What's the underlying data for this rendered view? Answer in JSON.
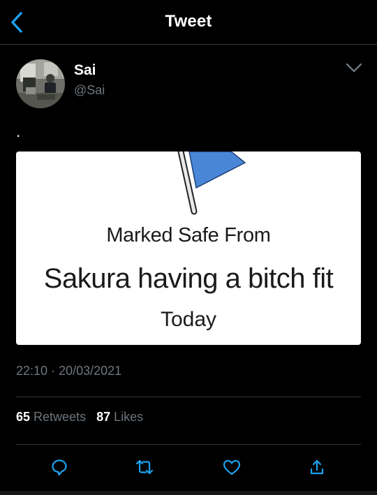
{
  "header": {
    "title": "Tweet",
    "back_icon": "chevron-left-icon",
    "accent_color": "#1da1f2"
  },
  "author": {
    "display_name": "Sai",
    "handle": "@Sai",
    "more_icon": "chevron-down-icon"
  },
  "tweet": {
    "text": ".",
    "media": {
      "line1": "Marked Safe From",
      "line2": "Sakura having a bitch fit",
      "line3": "Today",
      "flag_color": "#4a86d8"
    },
    "time": "22:10",
    "separator": "·",
    "date": "20/03/2021"
  },
  "stats": {
    "retweets_count": "65",
    "retweets_label": "Retweets",
    "likes_count": "87",
    "likes_label": "Likes"
  },
  "actions": [
    {
      "name": "reply",
      "icon": "reply-icon"
    },
    {
      "name": "retweet",
      "icon": "retweet-icon"
    },
    {
      "name": "like",
      "icon": "heart-icon"
    },
    {
      "name": "share",
      "icon": "share-icon"
    }
  ],
  "colors": {
    "background": "#000000",
    "secondary_text": "#6e767d",
    "divider": "#2f3336"
  }
}
